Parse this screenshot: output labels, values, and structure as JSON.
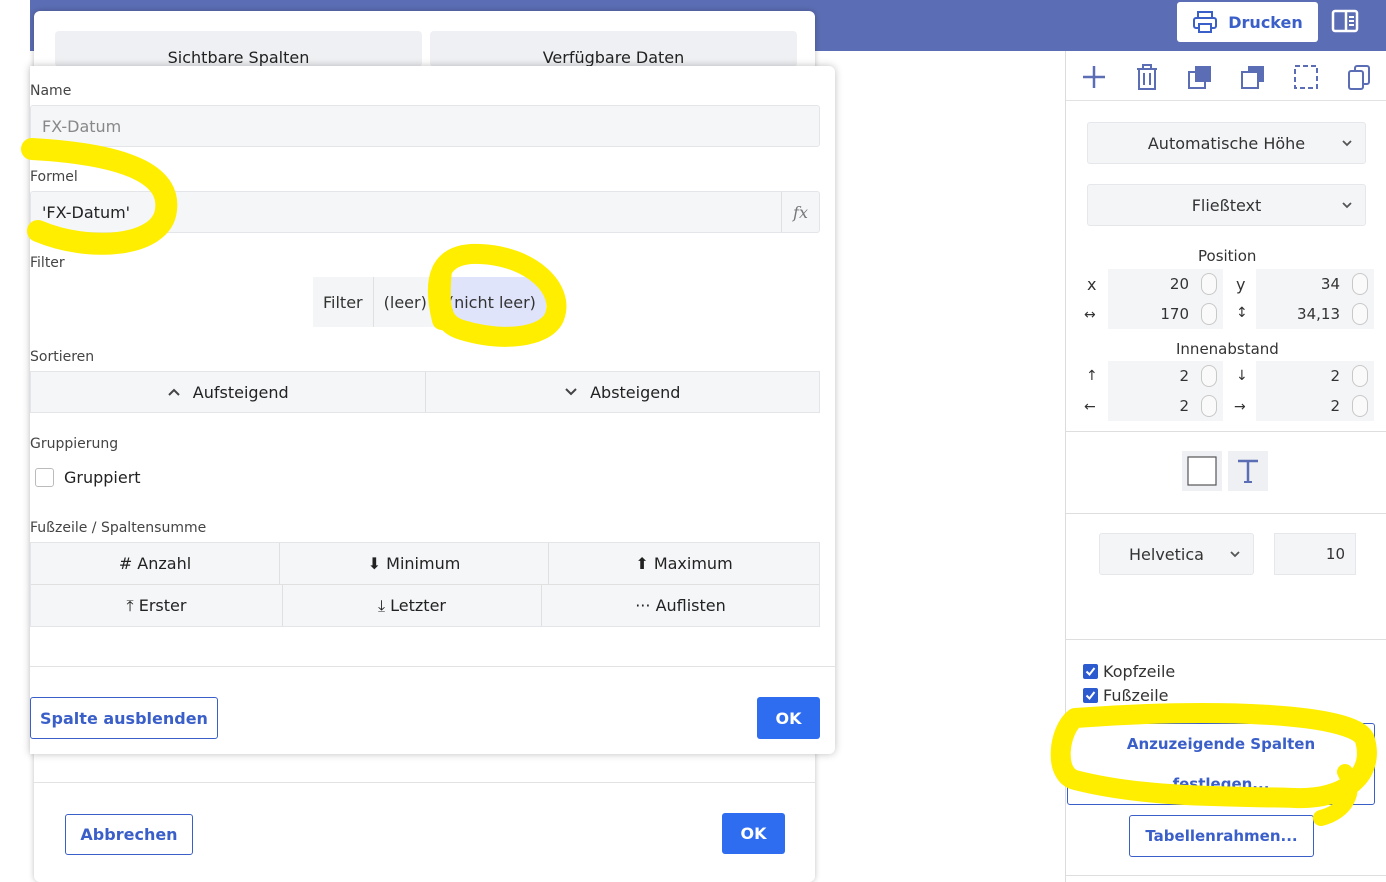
{
  "topbar": {
    "print_label": "Drucken"
  },
  "background_dialog": {
    "tabs": [
      {
        "label": "Sichtbare Spalten"
      },
      {
        "label": "Verfügbare Daten"
      }
    ],
    "cancel_label": "Abbrechen",
    "ok_label": "OK"
  },
  "column_dialog": {
    "name": {
      "label": "Name",
      "placeholder": "FX-Datum"
    },
    "formula": {
      "label": "Formel",
      "value": "'FX-Datum'",
      "fx_symbol": "fx"
    },
    "filter": {
      "label": "Filter",
      "options": [
        {
          "label": "Filter",
          "selected": false
        },
        {
          "label": "(leer)",
          "selected": false
        },
        {
          "label": "(nicht leer)",
          "selected": true
        }
      ]
    },
    "sort": {
      "label": "Sortieren",
      "ascending": "Aufsteigend",
      "descending": "Absteigend"
    },
    "grouping": {
      "label": "Gruppierung",
      "checkbox_label": "Gruppiert",
      "checked": false
    },
    "footer": {
      "label": "Fußzeile / Spaltensumme",
      "row1": [
        {
          "label": "# Anzahl"
        },
        {
          "label": "⬇ Minimum"
        },
        {
          "label": "⬆ Maximum"
        }
      ],
      "row2": [
        {
          "label": "⤒ Erster"
        },
        {
          "label": "⤓ Letzter"
        },
        {
          "label": "··· Auflisten"
        }
      ]
    },
    "hide_column_label": "Spalte ausblenden",
    "ok_label": "OK"
  },
  "right_panel": {
    "toolbar_icons": [
      "plus-icon",
      "trash-icon",
      "bring-to-front-icon",
      "send-to-back-icon",
      "select-area-icon",
      "copy-icon"
    ],
    "height_select": "Automatische Höhe",
    "text_select": "Fließtext",
    "position": {
      "title": "Position",
      "x_label": "x",
      "y_label": "y",
      "w_label": "↔",
      "h_label": "↕",
      "x": "20",
      "y": "34",
      "width": "170",
      "height": "34,13"
    },
    "padding": {
      "title": "Innenabstand",
      "top_label": "↑",
      "bottom_label": "↓",
      "left_label": "←",
      "right_label": "→",
      "top": "2",
      "bottom": "2",
      "left": "2",
      "right": "2"
    },
    "font": {
      "family": "Helvetica",
      "size": "10"
    },
    "header_checkbox": {
      "label": "Kopfzeile",
      "checked": true
    },
    "footer_checkbox": {
      "label": "Fußzeile",
      "checked": true
    },
    "columns_button": {
      "line1": "Anzuzeigende Spalten",
      "line2": "festlegen..."
    },
    "table_border_button": "Tabellenrahmen..."
  },
  "colors": {
    "topbar": "#5b6db4",
    "accent": "#3b5fc9",
    "primary": "#2f6df0",
    "highlight": "#ffee00"
  }
}
